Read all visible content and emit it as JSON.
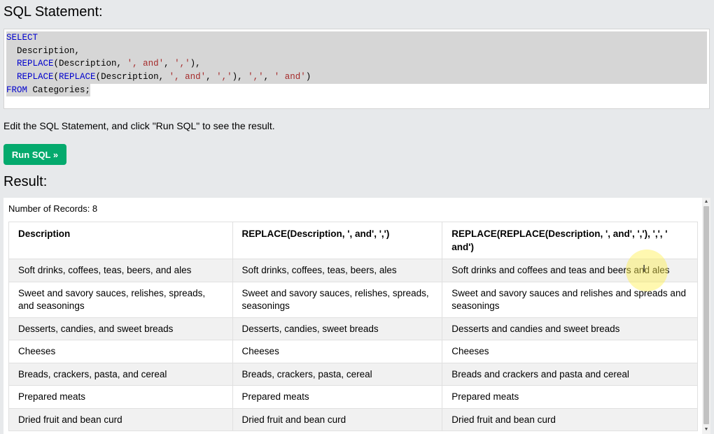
{
  "headings": {
    "sql": "SQL Statement:",
    "result": "Result:"
  },
  "editor": {
    "lines": [
      [
        {
          "t": "SELECT",
          "c": "kw"
        }
      ],
      [
        {
          "t": "  Description,",
          "c": ""
        }
      ],
      [
        {
          "t": "  ",
          "c": ""
        },
        {
          "t": "REPLACE",
          "c": "kw"
        },
        {
          "t": "(Description, ",
          "c": ""
        },
        {
          "t": "', and'",
          "c": "str"
        },
        {
          "t": ", ",
          "c": ""
        },
        {
          "t": "','",
          "c": "str"
        },
        {
          "t": "),",
          "c": ""
        }
      ],
      [
        {
          "t": "  ",
          "c": ""
        },
        {
          "t": "REPLACE",
          "c": "kw"
        },
        {
          "t": "(",
          "c": ""
        },
        {
          "t": "REPLACE",
          "c": "kw"
        },
        {
          "t": "(Description, ",
          "c": ""
        },
        {
          "t": "', and'",
          "c": "str"
        },
        {
          "t": ", ",
          "c": ""
        },
        {
          "t": "','",
          "c": "str"
        },
        {
          "t": "), ",
          "c": ""
        },
        {
          "t": "','",
          "c": "str"
        },
        {
          "t": ", ",
          "c": ""
        },
        {
          "t": "' and'",
          "c": "str"
        },
        {
          "t": ")",
          "c": ""
        }
      ],
      [
        {
          "t": "FROM",
          "c": "kw"
        },
        {
          "t": " Categories;",
          "c": ""
        }
      ]
    ]
  },
  "instructions": "Edit the SQL Statement, and click \"Run SQL\" to see the result.",
  "run_button": "Run SQL »",
  "result": {
    "record_count": "Number of Records: 8",
    "columns": [
      "Description",
      "REPLACE(Description, ', and', ',')",
      "REPLACE(REPLACE(Description, ', and', ','), ',', ' and')"
    ],
    "rows": [
      [
        "Soft drinks, coffees, teas, beers, and ales",
        "Soft drinks, coffees, teas, beers, ales",
        "Soft drinks and coffees and teas and beers and ales"
      ],
      [
        "Sweet and savory sauces, relishes, spreads, and seasonings",
        "Sweet and savory sauces, relishes, spreads, seasonings",
        "Sweet and savory sauces and relishes and spreads and seasonings"
      ],
      [
        "Desserts, candies, and sweet breads",
        "Desserts, candies, sweet breads",
        "Desserts and candies and sweet breads"
      ],
      [
        "Cheeses",
        "Cheeses",
        "Cheeses"
      ],
      [
        "Breads, crackers, pasta, and cereal",
        "Breads, crackers, pasta, cereal",
        "Breads and crackers and pasta and cereal"
      ],
      [
        "Prepared meats",
        "Prepared meats",
        "Prepared meats"
      ],
      [
        "Dried fruit and bean curd",
        "Dried fruit and bean curd",
        "Dried fruit and bean curd"
      ]
    ]
  },
  "colors": {
    "run_button": "#04aa6d",
    "keyword": "#0000cd",
    "string": "#a52a2a",
    "background": "#e7e9eb"
  },
  "icons": {
    "scroll_up": "▲",
    "scroll_down": "▼",
    "text_cursor": "I"
  }
}
